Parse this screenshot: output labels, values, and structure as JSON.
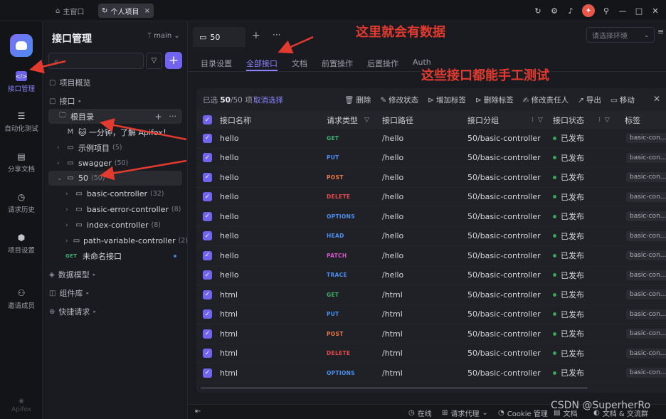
{
  "titlebar": {
    "home_tab": "主窗口",
    "project_tab": "个人项目",
    "close": "×"
  },
  "rail": {
    "items": [
      {
        "label": "接口管理",
        "icon": "api-icon"
      },
      {
        "label": "自动化测试",
        "icon": "automation-icon"
      },
      {
        "label": "分享文档",
        "icon": "share-doc-icon"
      },
      {
        "label": "请求历史",
        "icon": "history-icon"
      },
      {
        "label": "项目设置",
        "icon": "settings-icon"
      },
      {
        "label": "邀请成员",
        "icon": "invite-icon"
      }
    ],
    "footer": "Apifox"
  },
  "sidebar": {
    "title": "接口管理",
    "branch": "main",
    "overview": "项目概览",
    "api_section": "接口",
    "root": "根目录",
    "tree": [
      {
        "label": "🐱 一分钟，了解 Apifox！",
        "count": ""
      },
      {
        "label": "示例项目",
        "count": "(5)"
      },
      {
        "label": "swagger",
        "count": "(50)"
      },
      {
        "label": "50",
        "count": "(50)"
      },
      {
        "label": "basic-controller",
        "count": "(32)"
      },
      {
        "label": "basic-error-controller",
        "count": "(8)"
      },
      {
        "label": "index-controller",
        "count": "(8)"
      },
      {
        "label": "path-variable-controller",
        "count": "(2)"
      }
    ],
    "unnamed_method": "GET",
    "unnamed_api": "未命名接口",
    "data_models": "数据模型",
    "components": "组件库",
    "quick_requests": "快捷请求"
  },
  "main": {
    "tab_label": "50",
    "env_placeholder": "请选择环境",
    "subtabs": [
      "目录设置",
      "全部接口",
      "文档",
      "前置操作",
      "后置操作",
      "Auth"
    ],
    "annotations": [
      "这里就会有数据",
      "这些接口都能手工测试"
    ],
    "toolbar": {
      "selected_prefix": "已选",
      "selected": "50",
      "selected_suffix": "/50 项",
      "cancel": "取消选择",
      "actions": [
        "删除",
        "修改状态",
        "增加标签",
        "删除标签",
        "修改责任人",
        "导出",
        "移动"
      ]
    },
    "columns": [
      "接口名称",
      "请求类型",
      "接口路径",
      "接口分组",
      "接口状态",
      "标签"
    ],
    "rows": [
      {
        "name": "hello",
        "method": "GET",
        "path": "/hello",
        "group": "50/basic-controller",
        "status": "已发布",
        "tag": "basic-con..."
      },
      {
        "name": "hello",
        "method": "PUT",
        "path": "/hello",
        "group": "50/basic-controller",
        "status": "已发布",
        "tag": "basic-con..."
      },
      {
        "name": "hello",
        "method": "POST",
        "path": "/hello",
        "group": "50/basic-controller",
        "status": "已发布",
        "tag": "basic-con..."
      },
      {
        "name": "hello",
        "method": "DELETE",
        "path": "/hello",
        "group": "50/basic-controller",
        "status": "已发布",
        "tag": "basic-con..."
      },
      {
        "name": "hello",
        "method": "OPTIONS",
        "path": "/hello",
        "group": "50/basic-controller",
        "status": "已发布",
        "tag": "basic-con..."
      },
      {
        "name": "hello",
        "method": "HEAD",
        "path": "/hello",
        "group": "50/basic-controller",
        "status": "已发布",
        "tag": "basic-con..."
      },
      {
        "name": "hello",
        "method": "PATCH",
        "path": "/hello",
        "group": "50/basic-controller",
        "status": "已发布",
        "tag": "basic-con..."
      },
      {
        "name": "hello",
        "method": "TRACE",
        "path": "/hello",
        "group": "50/basic-controller",
        "status": "已发布",
        "tag": "basic-con..."
      },
      {
        "name": "html",
        "method": "GET",
        "path": "/html",
        "group": "50/basic-controller",
        "status": "已发布",
        "tag": "basic-con..."
      },
      {
        "name": "html",
        "method": "PUT",
        "path": "/html",
        "group": "50/basic-controller",
        "status": "已发布",
        "tag": "basic-con..."
      },
      {
        "name": "html",
        "method": "POST",
        "path": "/html",
        "group": "50/basic-controller",
        "status": "已发布",
        "tag": "basic-con..."
      },
      {
        "name": "html",
        "method": "DELETE",
        "path": "/html",
        "group": "50/basic-controller",
        "status": "已发布",
        "tag": "basic-con..."
      },
      {
        "name": "html",
        "method": "OPTIONS",
        "path": "/html",
        "group": "50/basic-controller",
        "status": "已发布",
        "tag": "basic-con..."
      }
    ]
  },
  "statusbar": {
    "online": "在线",
    "proxy": "请求代理",
    "cookie": "Cookie 管理",
    "docs": "文档",
    "community": "文档 & 交流群"
  },
  "watermark": "CSDN @SuperherRo",
  "colors": {
    "accent": "#7064f0",
    "method_colors": {
      "GET": "#3fae6a",
      "PUT": "#4a8ef0",
      "POST": "#e8784a",
      "DELETE": "#e5484d",
      "OPTIONS": "#4a8ef0",
      "HEAD": "#4a8ef0",
      "PATCH": "#d257c9",
      "TRACE": "#4a8ef0"
    },
    "annotation": "#e23a2f"
  }
}
